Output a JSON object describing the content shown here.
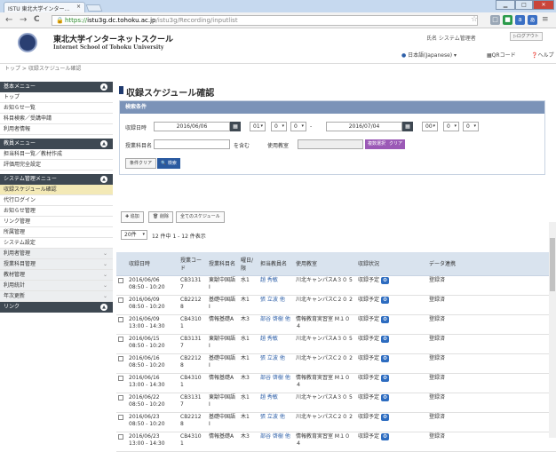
{
  "browser": {
    "tab_title": "ISTU 東北大学インター…",
    "tab_close": "×",
    "win_minimize": "▁",
    "win_maximize": "□",
    "win_close": "✕",
    "back": "←",
    "forward": "→",
    "reload": "C",
    "url_scheme": "https://",
    "url_host": "istu3g.dc.tohoku.ac.jp",
    "url_path": "/istu3g/Recording/inputlist"
  },
  "site": {
    "name": "東北大学インターネットスクール",
    "subtitle": "Internet School of Tohoku University",
    "user": "氏名 システム管理者",
    "logout": "ログアウト",
    "language": "日本語(Japanese)",
    "qr": "QRコード",
    "help": "ヘルプ"
  },
  "breadcrumb": "トップ > 収録スケジュール確認",
  "sidebar": {
    "sections": [
      {
        "header": "基本メニュー",
        "items": [
          "トップ",
          "お知らせ一覧",
          "科目検索／受講申請",
          "利用者情報"
        ]
      },
      {
        "header": "教員メニュー",
        "items": [
          "担当科目一覧／教材作成",
          "評価用完全設定"
        ]
      },
      {
        "header": "システム管理メニュー",
        "items": [
          "収録スケジュール確認",
          "代行ログイン",
          "お知らせ管理",
          "リンク管理",
          "所属管理",
          "システム設定"
        ]
      }
    ],
    "groups": [
      "利用者管理",
      "授業科目管理",
      "教材管理",
      "利用統計",
      "年次更新"
    ],
    "link_header": "リンク",
    "active_item": "収録スケジュール確認"
  },
  "page": {
    "title": "収録スケジュール確認",
    "search": {
      "heading": "検索条件",
      "date_label": "収録日時",
      "date_from": "2016/06/06",
      "date_to": "2016/07/04",
      "hour_from": "01",
      "min_from_a": "0",
      "min_from_b": "0",
      "range_sep": "-",
      "hour_to": "00",
      "min_to_a": "0",
      "min_to_b": "0",
      "subject_label": "授業科目名",
      "contains": "を含む",
      "room_label": "使用教室",
      "multi_select": "複数選択",
      "clear_small": "クリア",
      "clear_btn": "条件クリア",
      "search_btn": "検索"
    },
    "actions": {
      "register": "追加",
      "delete": "削除",
      "all_schedule": "全てのスケジュール"
    },
    "per_page": "20件",
    "count_info": "12 件中 1 - 12 件表示",
    "columns": [
      "収録日時",
      "授業コード",
      "授業科目名",
      "曜日/限",
      "担当教員名",
      "使用教室",
      "収録状況",
      "データ連携"
    ],
    "rows": [
      {
        "date": "2016/06/06",
        "time": "08:50 - 10:20",
        "code": "CB3131 7",
        "name": "東獣中国語 I",
        "day": "水1",
        "teacher": "趙 秀敏",
        "room": "川北キャンパスA３０ 5",
        "status": "収録予定",
        "sync": "登録済"
      },
      {
        "date": "2016/06/09",
        "time": "08:50 - 10:20",
        "code": "CB2212 8",
        "name": "基礎中国語 I",
        "day": "木1",
        "teacher": "張 立波 他",
        "room": "川北キャンパスC２０ 2",
        "status": "収録予定",
        "sync": "登録済"
      },
      {
        "date": "2016/06/09",
        "time": "13:00 - 14:30",
        "code": "CB4310 1",
        "name": "情報基礎A",
        "day": "木3",
        "teacher": "部谷 啓樹 他",
        "room": "情報教育実習室 M１０４",
        "status": "収録予定",
        "sync": "登録済"
      },
      {
        "date": "2016/06/15",
        "time": "08:50 - 10:20",
        "code": "CB3131 7",
        "name": "東獣中国語 I",
        "day": "水1",
        "teacher": "趙 秀敏",
        "room": "川北キャンパスA３０ 5",
        "status": "収録予定",
        "sync": "登録済"
      },
      {
        "date": "2016/06/16",
        "time": "08:50 - 10:20",
        "code": "CB2212 8",
        "name": "基礎中国語 I",
        "day": "木1",
        "teacher": "張 立波 他",
        "room": "川北キャンパスC２０ 2",
        "status": "収録予定",
        "sync": "登録済"
      },
      {
        "date": "2016/06/16",
        "time": "13:00 - 14:30",
        "code": "CB4310 1",
        "name": "情報基礎A",
        "day": "木3",
        "teacher": "部谷 啓樹 他",
        "room": "情報教育実習室 M１０４",
        "status": "収録予定",
        "sync": "登録済"
      },
      {
        "date": "2016/06/22",
        "time": "08:50 - 10:20",
        "code": "CB3131 7",
        "name": "東獣中国語 I",
        "day": "水1",
        "teacher": "趙 秀敏",
        "room": "川北キャンパスA３０ 5",
        "status": "収録予定",
        "sync": "登録済"
      },
      {
        "date": "2016/06/23",
        "time": "08:50 - 10:20",
        "code": "CB2212 8",
        "name": "基礎中国語 I",
        "day": "木1",
        "teacher": "張 立波 他",
        "room": "川北キャンパスC２０ 2",
        "status": "収録予定",
        "sync": "登録済"
      },
      {
        "date": "2016/06/23",
        "time": "13:00 - 14:30",
        "code": "CB4310 1",
        "name": "情報基礎A",
        "day": "木3",
        "teacher": "部谷 啓樹 他",
        "room": "情報教育実習室 M１０４",
        "status": "収録予定",
        "sync": "登録済"
      }
    ]
  },
  "colors": {
    "sidebar_header": "#3e4852",
    "panel_header": "#7b93b8",
    "active_item": "#f3e9b6",
    "primary": "#2a5aa0"
  }
}
